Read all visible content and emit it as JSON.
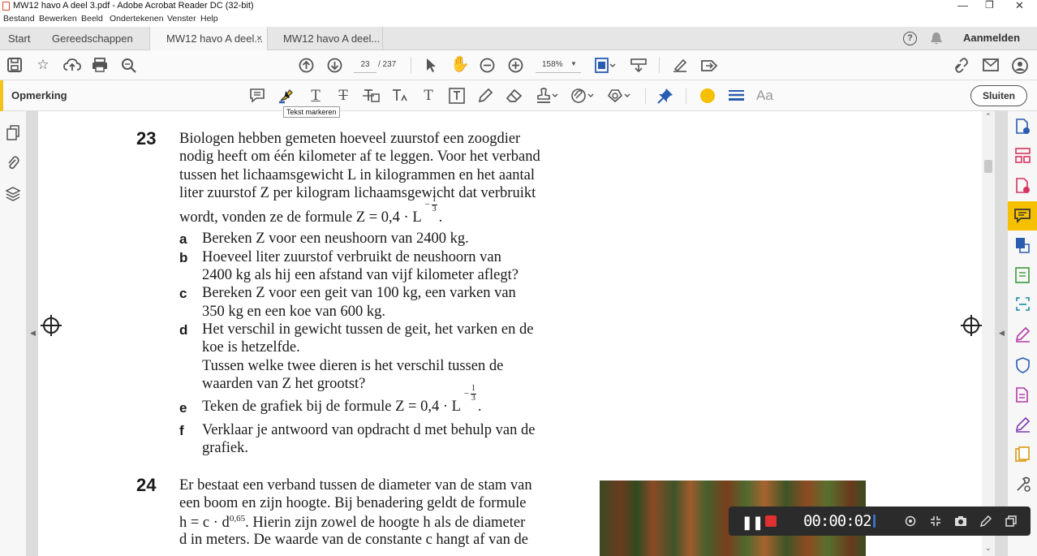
{
  "window": {
    "title": "MW12 havo A deel 3.pdf - Adobe Acrobat Reader DC (32-bit)",
    "controls": [
      "—",
      "❐",
      "✕"
    ]
  },
  "menu": [
    "Bestand",
    "Bewerken",
    "Beeld",
    "Ondertekenen",
    "Venster",
    "Help"
  ],
  "tabs": {
    "home": "Start",
    "tools": "Gereedschappen",
    "doc1": "MW12 havo A deel...",
    "doc2": "MW12 havo A deel...",
    "close": "×",
    "signin": "Aanmelden",
    "help": "?"
  },
  "toolbar": {
    "page_current": "23",
    "page_total": "/ 237",
    "zoom": "158%"
  },
  "commentbar": {
    "label": "Opmerking",
    "tooltip": "Tekst markeren",
    "close": "Sluiten",
    "text_tool": "T",
    "font_tool": "Aa",
    "color": "#f5c000"
  },
  "document": {
    "q23": {
      "num": "23",
      "lines": [
        "Biologen hebben gemeten hoeveel zuurstof een zoogdier",
        "nodig heeft om één kilometer af te leggen. Voor het verband",
        "tussen het lichaamsgewicht L in kilogrammen en het aantal",
        "liter zuurstof Z per kilogram lichaamsgewicht dat verbruikt",
        "wordt, vonden ze de formule Z = 0,4 · L"
      ],
      "exponent": "−",
      "exp_num": "1",
      "exp_den": "3",
      "items": [
        {
          "letter": "a",
          "lines": [
            "Bereken Z voor een neushoorn van 2400 kg."
          ]
        },
        {
          "letter": "b",
          "lines": [
            "Hoeveel liter zuurstof verbruikt de neushoorn van",
            "2400 kg als hij een afstand van vijf kilometer aflegt?"
          ]
        },
        {
          "letter": "c",
          "lines": [
            "Bereken Z voor een geit van 100 kg, een varken van",
            "350 kg en een koe van 600 kg."
          ]
        },
        {
          "letter": "d",
          "lines": [
            "Het verschil in gewicht tussen de geit, het varken en de",
            "koe is hetzelfde.",
            "Tussen welke twee dieren is het verschil tussen de",
            "waarden van Z het grootst?"
          ]
        },
        {
          "letter": "e",
          "lines": [
            "Teken de grafiek bij de formule Z = 0,4 · L"
          ]
        },
        {
          "letter": "f",
          "lines": [
            "Verklaar je antwoord van opdracht d met behulp van de",
            "grafiek."
          ]
        }
      ]
    },
    "q24": {
      "num": "24",
      "lines": [
        "Er bestaat een verband tussen de diameter van de stam van",
        "een boom en zijn hoogte. Bij benadering geldt de formule",
        "h = c · d",
        "d in meters. De waarde van de constante c hangt af van de"
      ],
      "exp": "0,65",
      "line3_rest": ". Hierin zijn zowel de hoogte h als de diameter"
    }
  },
  "recorder": {
    "time": "00:00:02"
  }
}
